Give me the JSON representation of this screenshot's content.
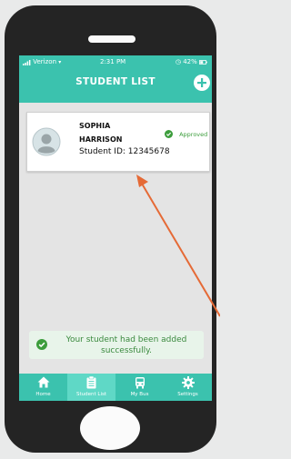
{
  "status_bar": {
    "carrier": "Verizon",
    "time": "2:31 PM",
    "battery": "42%"
  },
  "header": {
    "title": "STUDENT LIST",
    "add_icon": "plus-circle-icon"
  },
  "student": {
    "first_name": "SOPHIA",
    "last_name": "HARRISON",
    "student_id": "Student ID: 12345678",
    "status": "Approved",
    "status_color": "#3c9d3c"
  },
  "toast": {
    "message": "Your student had been added successfully.",
    "icon": "check-circle-icon"
  },
  "tabbar": {
    "tabs": [
      {
        "label": "Home",
        "icon": "home-icon"
      },
      {
        "label": "Student List",
        "icon": "clipboard-icon"
      },
      {
        "label": "My Bus",
        "icon": "bus-icon"
      },
      {
        "label": "Settings",
        "icon": "gear-icon"
      }
    ],
    "active": "Student List"
  },
  "colors": {
    "accent": "#3bc2ae",
    "active_tab": "#5fd8c6",
    "arrow": "#e56a36",
    "success": "#3c9d3c"
  }
}
